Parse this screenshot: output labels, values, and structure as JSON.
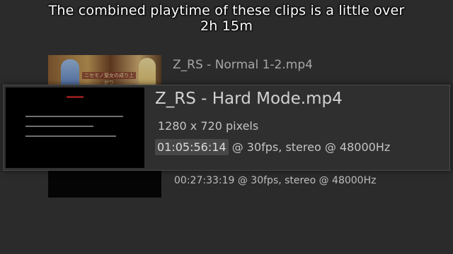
{
  "caption": {
    "line1": "The combined playtime of these clips is a little over",
    "line2": "2h 15m"
  },
  "items": [
    {
      "title": "Z_RS - Normal 1-2.mp4",
      "thumbnail_text": "ニセモノ聖女の成り上がり",
      "thumbnail_icon": "anime-thumbnail"
    },
    {
      "title": "Z_RS - Hard Mode.mp4",
      "resolution": "1280 x 720 pixels",
      "duration": "01:05:56:14",
      "stream_info": " @ 30fps, stereo @ 48000Hz",
      "thumbnail_icon": "black-text-thumbnail"
    },
    {
      "info": "00:27:33:19 @ 30fps, stereo @ 48000Hz",
      "thumbnail_icon": "black-thumbnail"
    }
  ],
  "colors": {
    "background": "#2b2b2b",
    "card": "#2f2f2f",
    "timecode_highlight": "#474747",
    "caption": "#ffffff"
  }
}
